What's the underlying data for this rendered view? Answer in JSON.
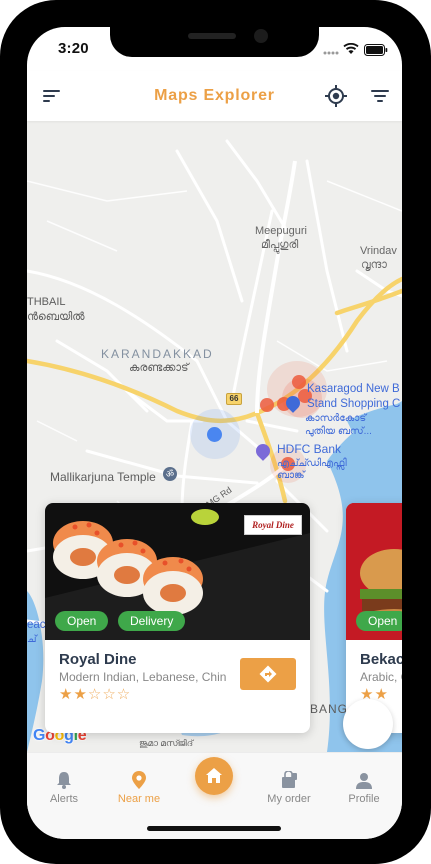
{
  "status_bar": {
    "time": "3:20"
  },
  "header": {
    "title": "Maps Explorer",
    "menu_icon": "sort-lines-icon",
    "locate_icon": "gps-target-icon",
    "filter_icon": "filter-lines-icon"
  },
  "map": {
    "labels": {
      "meepuguri_en": "Meepuguri",
      "meepuguri_ml": "മീപ്പുഗുരി",
      "vrinda_en": "Vrindav",
      "vrinda_ml": "വൃന്ദാ",
      "thbail_en": "THBAIL",
      "thbail_ml": "ൻബെയിൽ",
      "karandakkad_en": "KARANDAKKAD",
      "karandakkad_ml": "കരണ്ടക്കാട്",
      "busstand_1": "Kasaragod New B",
      "busstand_2": "Stand Shopping C",
      "busstand_ml1": "കാസർകോട്",
      "busstand_ml2": "പുതിയ ബസ്...",
      "hdfc_en": "HDFC Bank",
      "hdfc_ml1": "എച്ച്ഡിഎഫ്സി",
      "hdfc_ml2": "ബാങ്ക്",
      "temple": "Mallikarjuna Temple",
      "road_66": "66",
      "mg_road": "MG Rd",
      "bang": "BANG",
      "mosque_ml": "ജുമാ മസ്ജിദ്",
      "left_each": "each",
      "left_ml": "ച്",
      "google": "Google"
    }
  },
  "cards": [
    {
      "name": "Royal Dine",
      "cuisine": "Modern Indian, Lebanese, Chinese",
      "stars_on": "★★",
      "stars_off": "☆☆☆",
      "tag_open": "Open",
      "tag_delivery": "Delivery",
      "brand": "Royal Dine"
    },
    {
      "name": "Bekac",
      "cuisine": "Arabic, C",
      "stars_on": "★★",
      "stars_off": "",
      "tag_open": "Open"
    }
  ],
  "bottom_nav": {
    "items": [
      {
        "label": "Alerts",
        "icon": "bell-icon"
      },
      {
        "label": "Near me",
        "icon": "map-pin-icon"
      },
      {
        "label": "",
        "icon": "home-icon"
      },
      {
        "label": "My order",
        "icon": "order-bag-icon"
      },
      {
        "label": "Profile",
        "icon": "user-icon"
      }
    ],
    "active": "Near me"
  },
  "colors": {
    "accent": "#eca046",
    "open_tag": "#3fa84a",
    "title_text": "#2e3b4e",
    "marker_red": "#ec5a3c",
    "user_dot": "#4a86f0"
  }
}
